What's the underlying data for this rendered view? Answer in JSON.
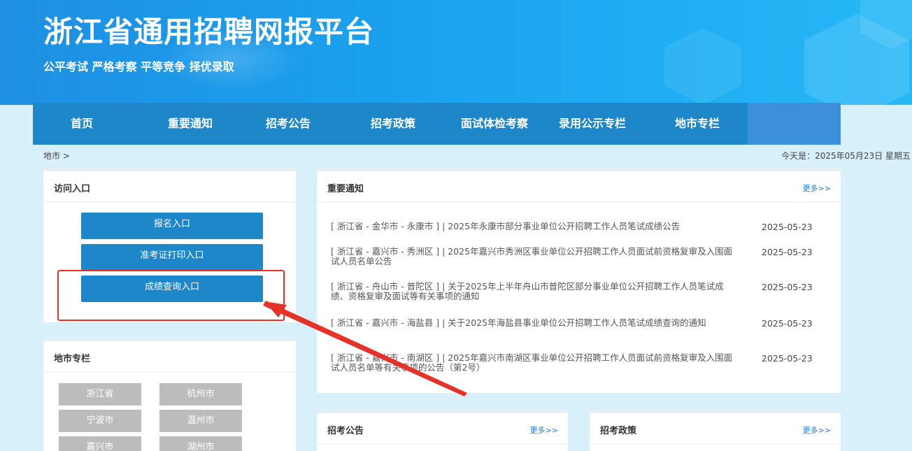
{
  "header": {
    "title": "浙江省通用招聘网报平台",
    "slogan": "公平考试 严格考察 平等竞争 择优录取"
  },
  "nav": {
    "items": [
      "首页",
      "重要通知",
      "招考公告",
      "招考政策",
      "面试体检考察",
      "录用公示专栏",
      "地市专栏"
    ]
  },
  "breadcrumb": "地市 >",
  "today": "今天是：2025年05月23日 星期五",
  "access": {
    "title": "访问入口",
    "buttons": [
      "报名入口",
      "准考证打印入口",
      "成绩查询入口"
    ]
  },
  "cities": {
    "title": "地市专栏",
    "items": [
      "浙江省",
      "杭州市",
      "宁波市",
      "温州市",
      "嘉兴市",
      "湖州市"
    ]
  },
  "notices": {
    "title": "重要通知",
    "more": "更多>>",
    "items": [
      {
        "text": "[ 浙江省 - 金华市 - 永康市 ] | 2025年永康市部分事业单位公开招聘工作人员笔试成绩公告",
        "date": "2025-05-23"
      },
      {
        "text": "[ 浙江省 - 嘉兴市 - 秀洲区 ] | 2025年嘉兴市秀洲区事业单位公开招聘工作人员面试前资格复审及入围面试人员名单公告",
        "date": "2025-05-23"
      },
      {
        "text": "[ 浙江省 - 舟山市 - 普陀区 ] | 关于2025年上半年舟山市普陀区部分事业单位公开招聘工作人员笔试成绩、资格复审及面试等有关事项的通知",
        "date": "2025-05-23"
      },
      {
        "text": "[ 浙江省 - 嘉兴市 - 海盐县 ] | 关于2025年海盐县事业单位公开招聘工作人员笔试成绩查询的通知",
        "date": "2025-05-23"
      },
      {
        "text": "[ 浙江省 - 嘉兴市 - 南湖区 ] | 2025年嘉兴市南湖区事业单位公开招聘工作人员面试前资格复审及入围面试人员名单等有关事项的公告（第2号）",
        "date": "2025-05-23"
      }
    ]
  },
  "recruit": {
    "title": "招考公告",
    "more": "更多>>"
  },
  "policy": {
    "title": "招考政策",
    "more": "更多>>"
  },
  "colors": {
    "nav": "#1e87c9",
    "banner": "#1aa2ef",
    "annotation": "#e53329"
  }
}
